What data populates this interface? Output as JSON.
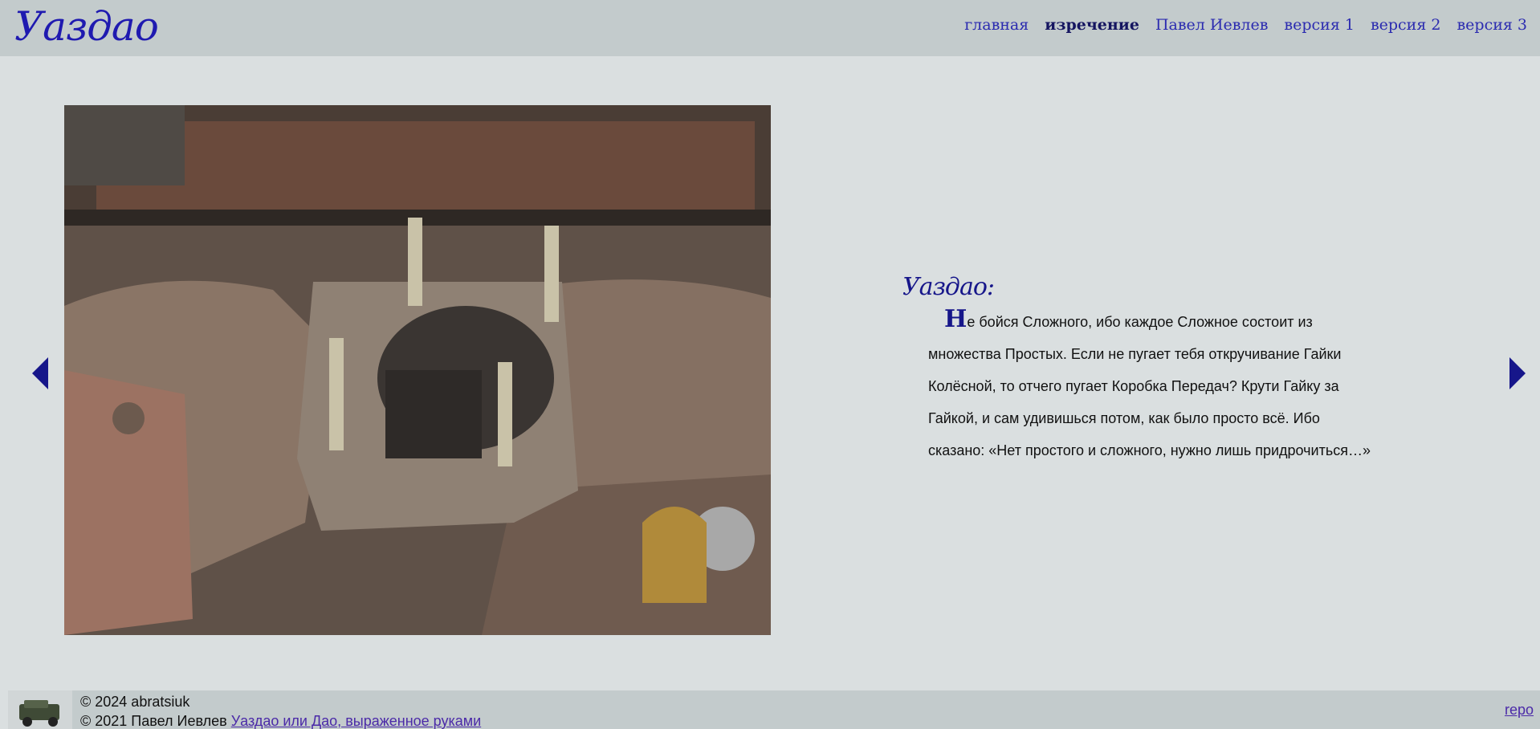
{
  "header": {
    "logo": "Уаздао",
    "nav": [
      {
        "label": "главная"
      },
      {
        "label": "изречение"
      },
      {
        "label": "Павел Иевлев"
      },
      {
        "label": "версия 1"
      },
      {
        "label": "версия 2"
      },
      {
        "label": "версия 3"
      }
    ]
  },
  "quote": {
    "title": "Уаздао:",
    "dropcap": "Н",
    "text": "е бойся Сложного, ибо каждое Сложное состоит из множества Простых. Если не пугает тебя откручивание Гайки Колёсной, то отчего пугает Коробка Передач? Крути Гайку за Гайкой, и сам удивишься потом, как было просто всё. Ибо сказано: «Нет простого и сложного, нужно лишь придрочиться…»"
  },
  "footer": {
    "line1": "© 2024 abratsiuk",
    "line2_prefix": "© 2021 Павел Иевлев",
    "line2_link": "Уаздао или Дао, выраженное руками",
    "repo": "repo"
  },
  "colors": {
    "accent": "#16168a",
    "link": "#2b2bb0",
    "header_bg": "#c3cbcc",
    "page_bg": "#dadfe0"
  }
}
